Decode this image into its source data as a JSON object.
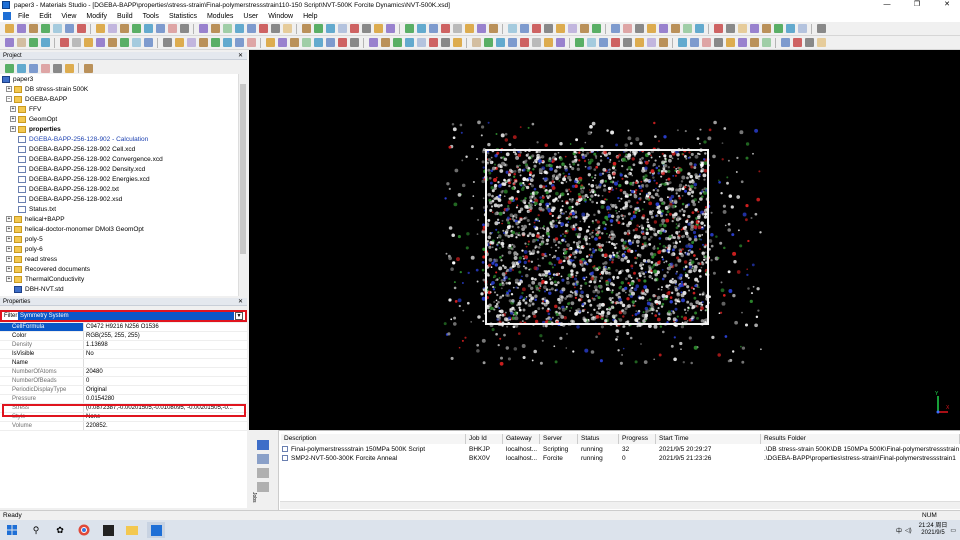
{
  "window": {
    "title": "paper3 - Materials Studio - [DGEBA-BAPP\\properties\\stress-strain\\Final-polymerstressstrain110-150 Script\\NVT-500K Forcite Dynamics\\NVT-500K.xsd]",
    "minimize": "—",
    "restore": "❐",
    "close": "✕"
  },
  "menu": [
    "File",
    "Edit",
    "View",
    "Modify",
    "Build",
    "Tools",
    "Statistics",
    "Modules",
    "User",
    "Window",
    "Help"
  ],
  "project": {
    "header": "Project",
    "tree": [
      {
        "label": "paper3",
        "indent": 0,
        "icon": "std",
        "exp": ""
      },
      {
        "label": "DB stress-strain 500K",
        "indent": 1,
        "icon": "folder",
        "exp": "+"
      },
      {
        "label": "DGEBA-BAPP",
        "indent": 1,
        "icon": "folder",
        "exp": "−"
      },
      {
        "label": "FFV",
        "indent": 2,
        "icon": "folder",
        "exp": "+"
      },
      {
        "label": "GeomOpt",
        "indent": 2,
        "icon": "folder",
        "exp": "+"
      },
      {
        "label": "properties",
        "indent": 2,
        "icon": "folder",
        "exp": "+",
        "bold": true
      },
      {
        "label": "DGEBA-BAPP-256-128-902 - Calculation",
        "indent": 2,
        "icon": "doc",
        "exp": "",
        "color": "#1a3fb0"
      },
      {
        "label": "DGEBA-BAPP-256-128-902 Cell.xcd",
        "indent": 2,
        "icon": "doc",
        "exp": ""
      },
      {
        "label": "DGEBA-BAPP-256-128-902 Convergence.xcd",
        "indent": 2,
        "icon": "doc",
        "exp": ""
      },
      {
        "label": "DGEBA-BAPP-256-128-902 Density.xcd",
        "indent": 2,
        "icon": "doc",
        "exp": ""
      },
      {
        "label": "DGEBA-BAPP-256-128-902 Energies.xcd",
        "indent": 2,
        "icon": "doc",
        "exp": ""
      },
      {
        "label": "DGEBA-BAPP-256-128-902.txt",
        "indent": 2,
        "icon": "doc",
        "exp": ""
      },
      {
        "label": "DGEBA-BAPP-256-128-902.xsd",
        "indent": 2,
        "icon": "doc",
        "exp": ""
      },
      {
        "label": "Status.txt",
        "indent": 2,
        "icon": "doc",
        "exp": ""
      },
      {
        "label": "helical+BAPP",
        "indent": 1,
        "icon": "folder",
        "exp": "+"
      },
      {
        "label": "helical-doctor-monomer DMol3 GeomOpt",
        "indent": 1,
        "icon": "folder",
        "exp": "+"
      },
      {
        "label": "poly-5",
        "indent": 1,
        "icon": "folder",
        "exp": "+"
      },
      {
        "label": "poly-6",
        "indent": 1,
        "icon": "folder",
        "exp": "+"
      },
      {
        "label": "read stress",
        "indent": 1,
        "icon": "folder",
        "exp": "+"
      },
      {
        "label": "Recovered documents",
        "indent": 1,
        "icon": "folder",
        "exp": "+"
      },
      {
        "label": "ThermalConductivity",
        "indent": 1,
        "icon": "folder",
        "exp": "+"
      },
      {
        "label": "DBH-NVT.std",
        "indent": 1,
        "icon": "std",
        "exp": ""
      }
    ]
  },
  "properties": {
    "header": "Properties",
    "filter_label": "Filter",
    "filter_value": "Symmetry System",
    "rows": [
      {
        "key": "CellFormula",
        "value": "C9472 H9216 N256 O1536",
        "selected": true
      },
      {
        "key": "Color",
        "value": "RGB(255, 255, 255)",
        "bold": true
      },
      {
        "key": "Density",
        "value": "1.13698"
      },
      {
        "key": "IsVisible",
        "value": "No",
        "bold": true
      },
      {
        "key": "Name",
        "value": "",
        "bold": true
      },
      {
        "key": "NumberOfAtoms",
        "value": "20480"
      },
      {
        "key": "NumberOfBeads",
        "value": "0"
      },
      {
        "key": "PeriodicDisplayType",
        "value": "Original"
      },
      {
        "key": "Pressure",
        "value": "0.0154280"
      },
      {
        "key": "Stress",
        "value": "(0.0872387,-0.00201505,-0.0108095, -0.00201505,-0..."
      },
      {
        "key": "Style",
        "value": "None"
      },
      {
        "key": "Volume",
        "value": "220852."
      }
    ]
  },
  "jobs": {
    "headers": [
      "Description",
      "Job Id",
      "Gateway",
      "Server",
      "Status",
      "Progress",
      "Start Time",
      "Results Folder"
    ],
    "rows": [
      [
        "Final-polymerstressstrain 150MPa 500K Script",
        "BHKJP",
        "localhost...",
        "Scripting",
        "running",
        "32",
        "2021/9/5 20:29:27",
        ".\\DB stress-strain 500K\\DB 150MPa 500K\\Final-polymerstressstrain"
      ],
      [
        "SMP2-NVT-500-300K Forcite Anneal",
        "BKX0V",
        "localhost...",
        "Forcite",
        "running",
        "0",
        "2021/9/5 21:23:26",
        ".\\DGEBA-BAPP\\properties\\stress-strain\\Final-polymerstressstrain1"
      ]
    ],
    "side_label": "Jobs"
  },
  "status": {
    "left": "Ready",
    "right": "NUM"
  },
  "taskbar": {
    "time": "21:24 周日",
    "date": "2021/9/5",
    "ime": "中",
    "colors": {
      "accent": "#0a57c7",
      "highlight": "#e0141e"
    }
  },
  "axes": {
    "y": "Y",
    "x": "X"
  }
}
